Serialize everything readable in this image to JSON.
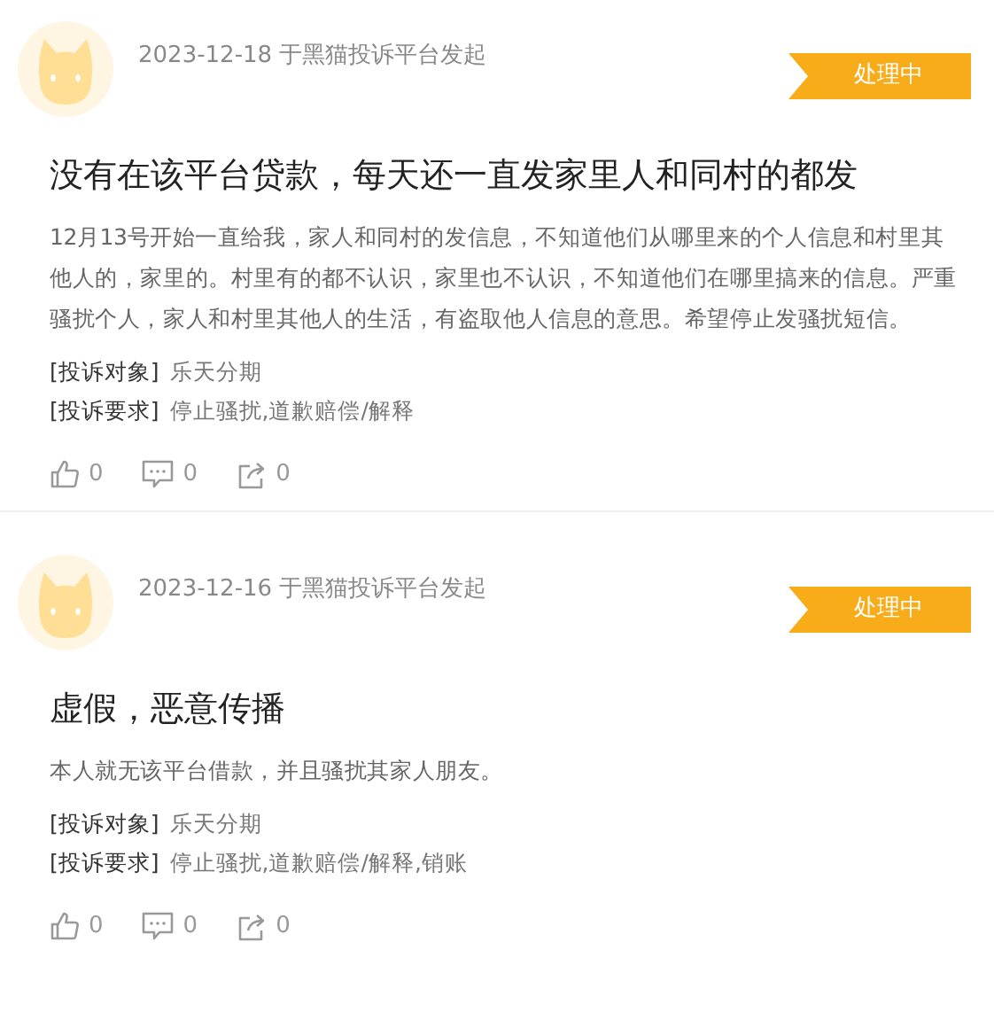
{
  "complaints": [
    {
      "date": "2023-12-18 于黑猫投诉平台发起",
      "status": "处理中",
      "title": "没有在该平台贷款，每天还一直发家里人和同村的都发",
      "body": "12月13号开始一直给我，家人和同村的发信息，不知道他们从哪里来的个人信息和村里其他人的，家里的。村里有的都不认识，家里也不认识，不知道他们在哪里搞来的信息。严重骚扰个人，家人和村里其他人的生活，有盗取他人信息的意思。希望停止发骚扰短信。",
      "target_label": "[投诉对象]",
      "target": "乐天分期",
      "demand_label": "[投诉要求]",
      "demand": "停止骚扰,道歉赔偿/解释",
      "likes": "0",
      "comments": "0",
      "shares": "0"
    },
    {
      "date": "2023-12-16 于黑猫投诉平台发起",
      "status": "处理中",
      "title": "虚假，恶意传播",
      "body": "本人就无该平台借款，并且骚扰其家人朋友。",
      "target_label": "[投诉对象]",
      "target": "乐天分期",
      "demand_label": "[投诉要求]",
      "demand": "停止骚扰,道歉赔偿/解释,销账",
      "likes": "0",
      "comments": "0",
      "shares": "0"
    }
  ]
}
